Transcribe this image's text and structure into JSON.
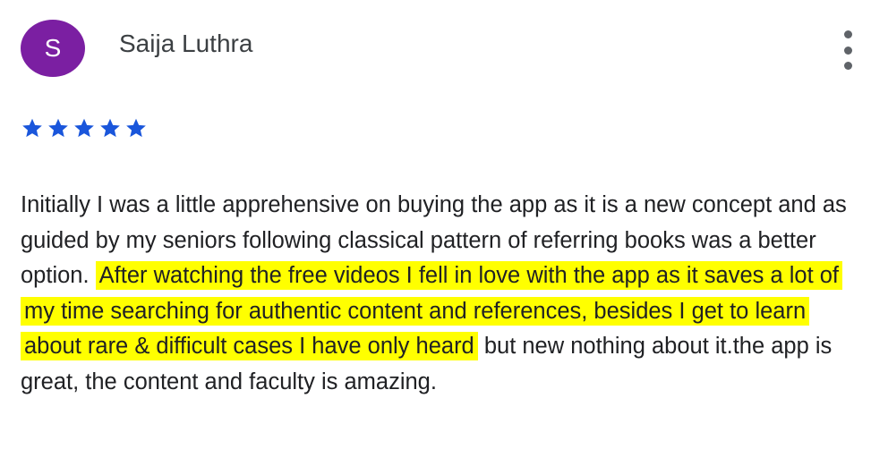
{
  "reviewer": {
    "initial": "S",
    "name": "Saija Luthra",
    "avatar_color": "#7b1fa2"
  },
  "menu_icon": "more-vert-icon",
  "rating": {
    "stars": 5,
    "max": 5,
    "star_color": "#1a56db",
    "icon": "star-icon"
  },
  "review": {
    "text_before": "Initially I was a little apprehensive on buying the app as it is a new concept and as guided by my seniors following classical pattern of referring books was a better option. ",
    "text_highlighted": "After watching the free videos I fell in love with the app as it saves a lot of my time searching for authentic content and references, besides I get to learn about rare & difficult cases I have only heard",
    "text_after": " but new nothing about it.the app is great, the content and faculty is amazing.",
    "highlight_color": "#ffff00"
  }
}
